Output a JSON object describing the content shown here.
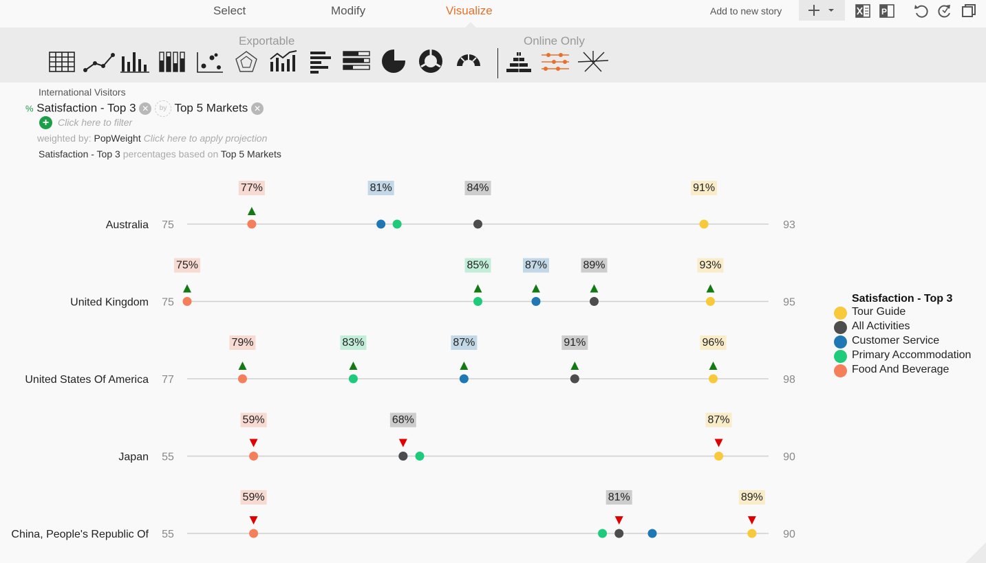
{
  "tabs": [
    {
      "label": "Select",
      "active": false
    },
    {
      "label": "Modify",
      "active": false
    },
    {
      "label": "Visualize",
      "active": true
    }
  ],
  "header": {
    "add_to_story": "Add to new story",
    "plus_icon": "plus-icon",
    "excel_icon": "excel-export-icon",
    "ppt_icon": "powerpoint-export-icon",
    "undo_icon": "undo-icon",
    "refresh_icon": "refresh-icon",
    "window_icon": "restore-window-icon"
  },
  "toolbar": {
    "exportable_label": "Exportable",
    "online_only_label": "Online Only",
    "icons": [
      "table-icon",
      "line-chart-icon",
      "column-chart-icon",
      "stacked-column-icon",
      "scatter-icon",
      "radar-icon",
      "combo-chart-icon",
      "bar-chart-icon",
      "stacked-bar-icon",
      "pie-chart-icon",
      "donut-chart-icon",
      "gauge-icon",
      "pyramid-icon",
      "dot-plot-icon",
      "network-icon"
    ],
    "active_icon": "dot-plot-icon",
    "accent": "#e8702a"
  },
  "query": {
    "dataset": "International Visitors",
    "percent_symbol": "%",
    "measure": "Satisfaction - Top 3",
    "by_label": "by",
    "dimension": "Top 5 Markets",
    "filter_placeholder": "Click here to filter",
    "weighted_label": "weighted by:",
    "weight": "PopWeight",
    "projection_placeholder": "Click here to apply projection",
    "basis_measure": "Satisfaction - Top 3",
    "basis_text": "percentages based on",
    "basis_dimension": "Top 5 Markets"
  },
  "chart_data": {
    "type": "dot-plot",
    "legend_title": "Satisfaction - Top 3",
    "series": [
      {
        "name": "Tour Guide",
        "color": "#f8c93a"
      },
      {
        "name": "All Activities",
        "color": "#4d4d4d"
      },
      {
        "name": "Customer Service",
        "color": "#1f77b4"
      },
      {
        "name": "Primary Accommodation",
        "color": "#1ecb7a"
      },
      {
        "name": "Food And Beverage",
        "color": "#f47f5a"
      }
    ],
    "up_color": "#137a13",
    "down_color": "#e00000",
    "rows": [
      {
        "category": "Australia",
        "min": 75,
        "max": 93,
        "values": {
          "Tour Guide": 91,
          "All Activities": 84,
          "Customer Service": 81,
          "Primary Accommodation": 81.5,
          "Food And Beverage": 77
        },
        "labels": [
          {
            "series": "Food And Beverage",
            "text": "77%",
            "trend": "up"
          },
          {
            "series": "Customer Service",
            "text": "81%",
            "trend": "none"
          },
          {
            "series": "All Activities",
            "text": "84%",
            "trend": "none"
          },
          {
            "series": "Tour Guide",
            "text": "91%",
            "trend": "none"
          }
        ]
      },
      {
        "category": "United Kingdom",
        "min": 75,
        "max": 95,
        "values": {
          "Tour Guide": 93,
          "All Activities": 89,
          "Customer Service": 87,
          "Primary Accommodation": 85,
          "Food And Beverage": 75
        },
        "labels": [
          {
            "series": "Food And Beverage",
            "text": "75%",
            "trend": "up"
          },
          {
            "series": "Primary Accommodation",
            "text": "85%",
            "trend": "up"
          },
          {
            "series": "Customer Service",
            "text": "87%",
            "trend": "up"
          },
          {
            "series": "All Activities",
            "text": "89%",
            "trend": "up"
          },
          {
            "series": "Tour Guide",
            "text": "93%",
            "trend": "up"
          }
        ]
      },
      {
        "category": "United States Of America",
        "min": 77,
        "max": 98,
        "values": {
          "Tour Guide": 96,
          "All Activities": 91,
          "Customer Service": 87,
          "Primary Accommodation": 83,
          "Food And Beverage": 79
        },
        "labels": [
          {
            "series": "Food And Beverage",
            "text": "79%",
            "trend": "up"
          },
          {
            "series": "Primary Accommodation",
            "text": "83%",
            "trend": "up"
          },
          {
            "series": "Customer Service",
            "text": "87%",
            "trend": "up"
          },
          {
            "series": "All Activities",
            "text": "91%",
            "trend": "up"
          },
          {
            "series": "Tour Guide",
            "text": "96%",
            "trend": "up"
          }
        ]
      },
      {
        "category": "Japan",
        "min": 55,
        "max": 90,
        "values": {
          "Tour Guide": 87,
          "All Activities": 68,
          "Customer Service": 68,
          "Primary Accommodation": 69,
          "Food And Beverage": 59
        },
        "labels": [
          {
            "series": "Food And Beverage",
            "text": "59%",
            "trend": "down"
          },
          {
            "series": "All Activities",
            "text": "68%",
            "trend": "down"
          },
          {
            "series": "Tour Guide",
            "text": "87%",
            "trend": "down"
          }
        ]
      },
      {
        "category": "China, People's Republic Of",
        "min": 55,
        "max": 90,
        "values": {
          "Tour Guide": 89,
          "All Activities": 81,
          "Customer Service": 83,
          "Primary Accommodation": 80,
          "Food And Beverage": 59
        },
        "labels": [
          {
            "series": "Food And Beverage",
            "text": "59%",
            "trend": "down"
          },
          {
            "series": "All Activities",
            "text": "81%",
            "trend": "down"
          },
          {
            "series": "Tour Guide",
            "text": "89%",
            "trend": "down"
          }
        ]
      }
    ]
  }
}
